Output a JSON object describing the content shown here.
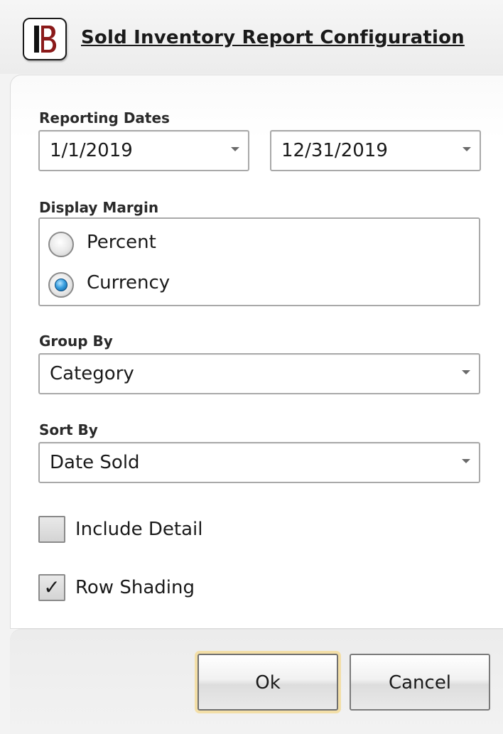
{
  "window": {
    "title": "Sold Inventory Report Configuration",
    "logo_icon": "brand-logo-b-icon",
    "accent_color": "#8b1a1a"
  },
  "reporting_dates": {
    "label": "Reporting Dates",
    "start_date": "1/1/2019",
    "end_date": "12/31/2019"
  },
  "display_margin": {
    "label": "Display Margin",
    "options": [
      {
        "label": "Percent",
        "checked": false
      },
      {
        "label": "Currency",
        "checked": true
      }
    ]
  },
  "group_by": {
    "label": "Group By",
    "value": "Category"
  },
  "sort_by": {
    "label": "Sort By",
    "value": "Date Sold"
  },
  "options": {
    "include_detail": {
      "label": "Include Detail",
      "checked": false
    },
    "row_shading": {
      "label": "Row Shading",
      "checked": true,
      "mark": "✓"
    }
  },
  "buttons": {
    "ok": "Ok",
    "cancel": "Cancel"
  }
}
